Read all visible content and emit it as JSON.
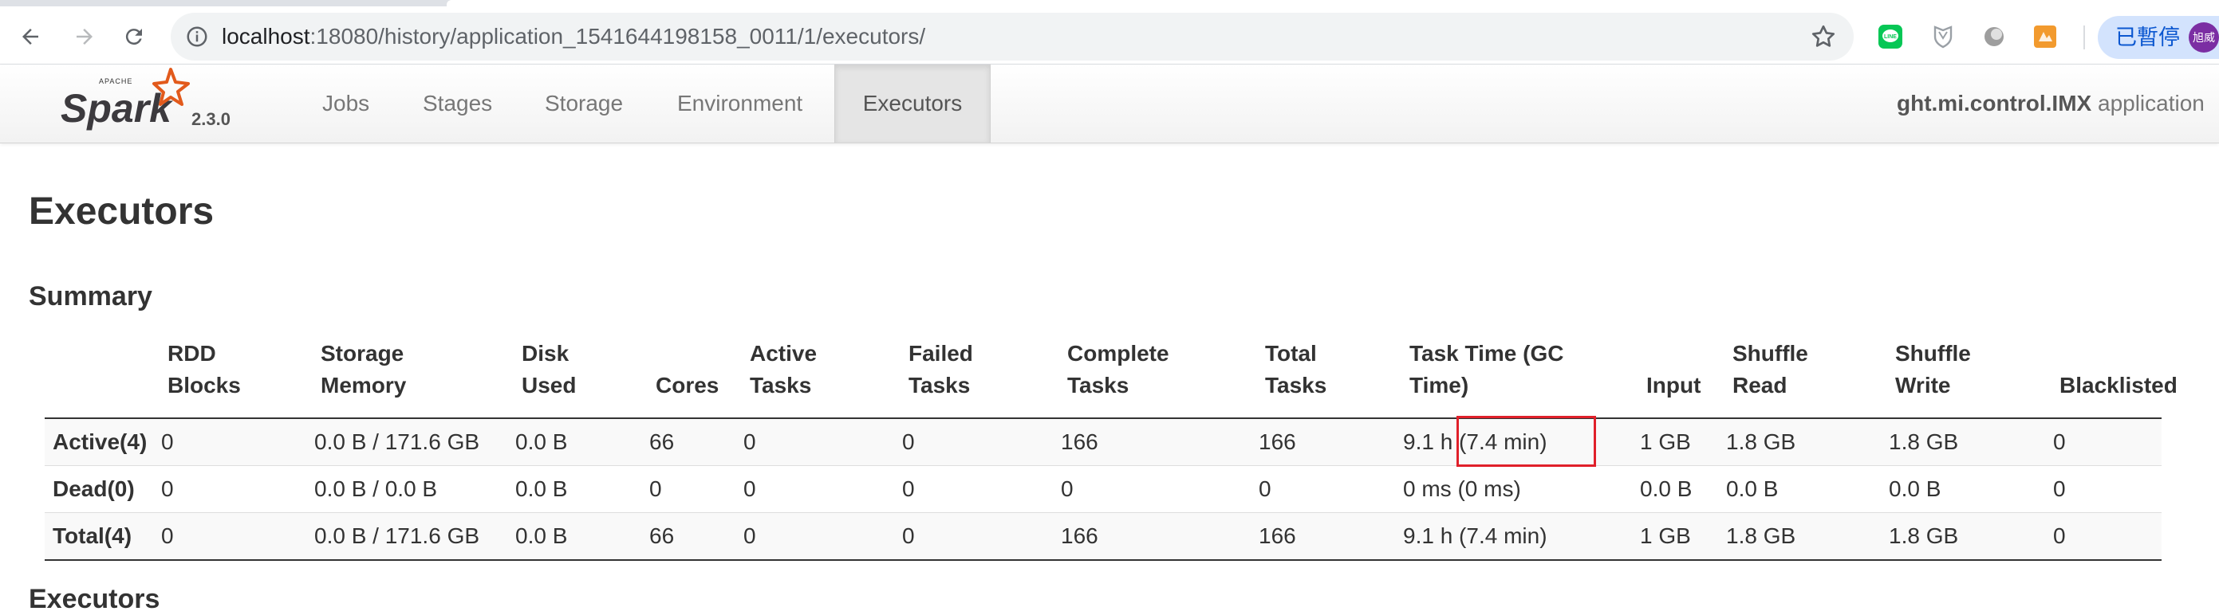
{
  "browser": {
    "url_host": "localhost",
    "url_rest": ":18080/history/application_1541644198158_0011/1/executors/",
    "paused_label": "已暫停",
    "avatar_text": "旭威",
    "icons": [
      "back-icon",
      "forward-icon",
      "reload-icon",
      "info-icon",
      "star-icon",
      "line-extension-icon",
      "shield-extension-icon",
      "circle-extension-icon",
      "orange-extension-icon"
    ]
  },
  "nav": {
    "version": "2.3.0",
    "tabs": [
      "Jobs",
      "Stages",
      "Storage",
      "Environment",
      "Executors"
    ],
    "active_tab": "Executors",
    "app_name_bold": "ght.mi.control.IMX",
    "app_name_suffix": " application"
  },
  "page": {
    "title": "Executors",
    "summary_heading": "Summary",
    "next_heading": "Executors"
  },
  "summary": {
    "headers": [
      [
        "",
        ""
      ],
      [
        "RDD",
        "Blocks"
      ],
      [
        "Storage",
        "Memory"
      ],
      [
        "Disk",
        "Used"
      ],
      [
        "",
        "Cores"
      ],
      [
        "Active",
        "Tasks"
      ],
      [
        "Failed",
        "Tasks"
      ],
      [
        "Complete",
        "Tasks"
      ],
      [
        "Total",
        "Tasks"
      ],
      [
        "Task Time (GC",
        "Time)"
      ],
      [
        "",
        "Input"
      ],
      [
        "Shuffle",
        "Read"
      ],
      [
        "Shuffle",
        "Write"
      ],
      [
        "",
        "Blacklisted"
      ]
    ],
    "rows": [
      [
        "Active(4)",
        "0",
        "0.0 B / 171.6 GB",
        "0.0 B",
        "66",
        "0",
        "0",
        "166",
        "166",
        "9.1 h (7.4 min)",
        "1 GB",
        "1.8 GB",
        "1.8 GB",
        "0"
      ],
      [
        "Dead(0)",
        "0",
        "0.0 B / 0.0 B",
        "0.0 B",
        "0",
        "0",
        "0",
        "0",
        "0",
        "0 ms (0 ms)",
        "0.0 B",
        "0.0 B",
        "0.0 B",
        "0"
      ],
      [
        "Total(4)",
        "0",
        "0.0 B / 171.6 GB",
        "0.0 B",
        "66",
        "0",
        "0",
        "166",
        "166",
        "9.1 h (7.4 min)",
        "1 GB",
        "1.8 GB",
        "1.8 GB",
        "0"
      ]
    ]
  },
  "colors": {
    "highlight_box": "#e0202a",
    "spark_orange": "#e25a1c",
    "paused_bg": "#d3e3fd"
  }
}
